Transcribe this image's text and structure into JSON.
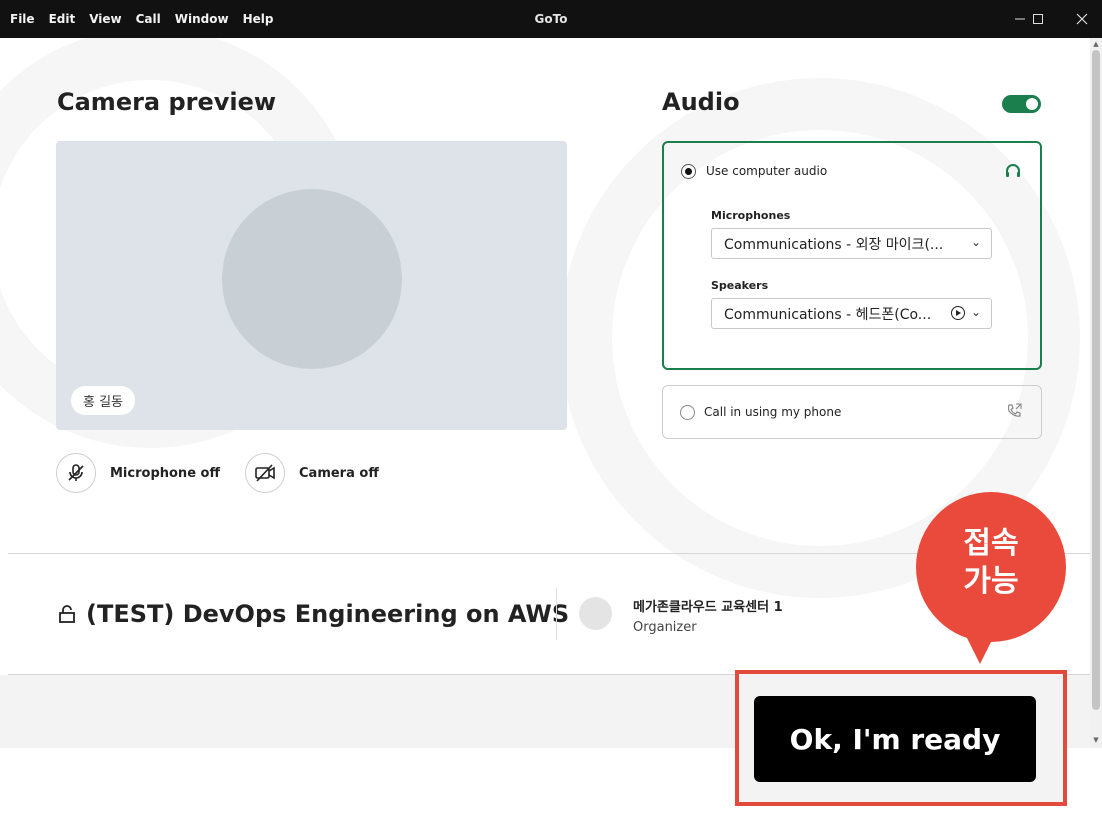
{
  "menu": [
    "File",
    "Edit",
    "View",
    "Call",
    "Window",
    "Help"
  ],
  "window": {
    "title": "GoTo"
  },
  "camera": {
    "heading": "Camera preview",
    "participant_name": "홍 길동",
    "microphone_label": "Microphone off",
    "camera_label": "Camera off"
  },
  "audio": {
    "heading": "Audio",
    "enabled": true,
    "computer_audio_label": "Use computer audio",
    "microphones_label": "Microphones",
    "microphone_value": "Communications - 외장 마이크(...",
    "speakers_label": "Speakers",
    "speaker_value": "Communications - 헤드폰(Co...",
    "phone_label": "Call in using my phone"
  },
  "meeting": {
    "title": "(TEST) DevOps Engineering on AWS",
    "organizer_name": "메가존클라우드 교육센터 1",
    "organizer_role": "Organizer"
  },
  "footer": {
    "ready_label": "Ok, I'm ready"
  },
  "annotation": {
    "line1": "접속",
    "line2": "가능"
  },
  "colors": {
    "accent": "#1a7f4c",
    "annotation": "#e94a3c",
    "titlebar": "#111111"
  }
}
